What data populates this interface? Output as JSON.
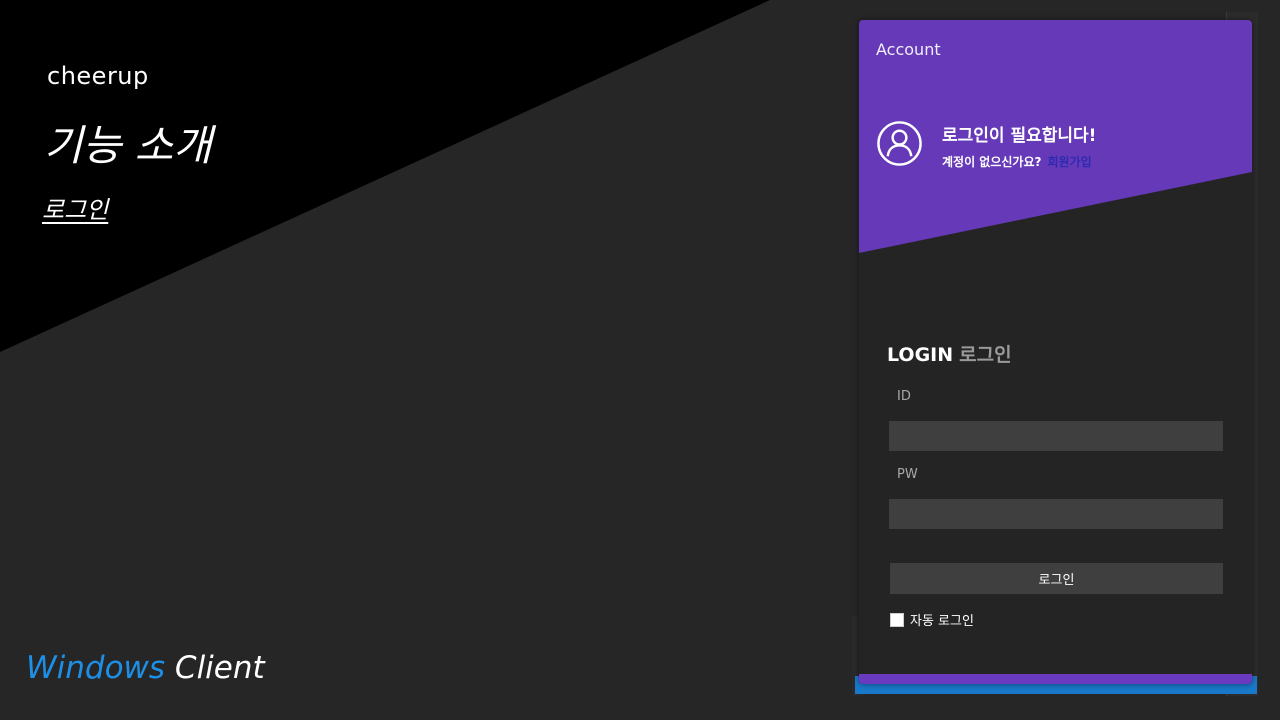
{
  "slide": {
    "brand": "cheerup",
    "title": "기능 소개",
    "subtitle": "로그인",
    "platform_accent": "Windows",
    "platform_rest": "Client"
  },
  "account_panel": {
    "title": "Account",
    "login_required": "로그인이 필요합니다!",
    "no_account_question": "계정이 없으신가요?",
    "signup_link": "회원가입",
    "login_heading_en": "LOGIN",
    "login_heading_ko": "로그인",
    "id_label": "ID",
    "id_value": "",
    "pw_label": "PW",
    "pw_value": "",
    "login_button": "로그인",
    "auto_login_label": "자동 로그인",
    "auto_login_checked": false
  },
  "icons": {
    "user": "user-circle-icon"
  },
  "colors": {
    "background": "#262626",
    "triangle": "#000000",
    "panel_accent": "#6539b8",
    "panel_body": "#242424",
    "input_bg": "#3f3f3f",
    "signup_link": "#2f2bb0",
    "platform_accent": "#1e8fe6"
  }
}
